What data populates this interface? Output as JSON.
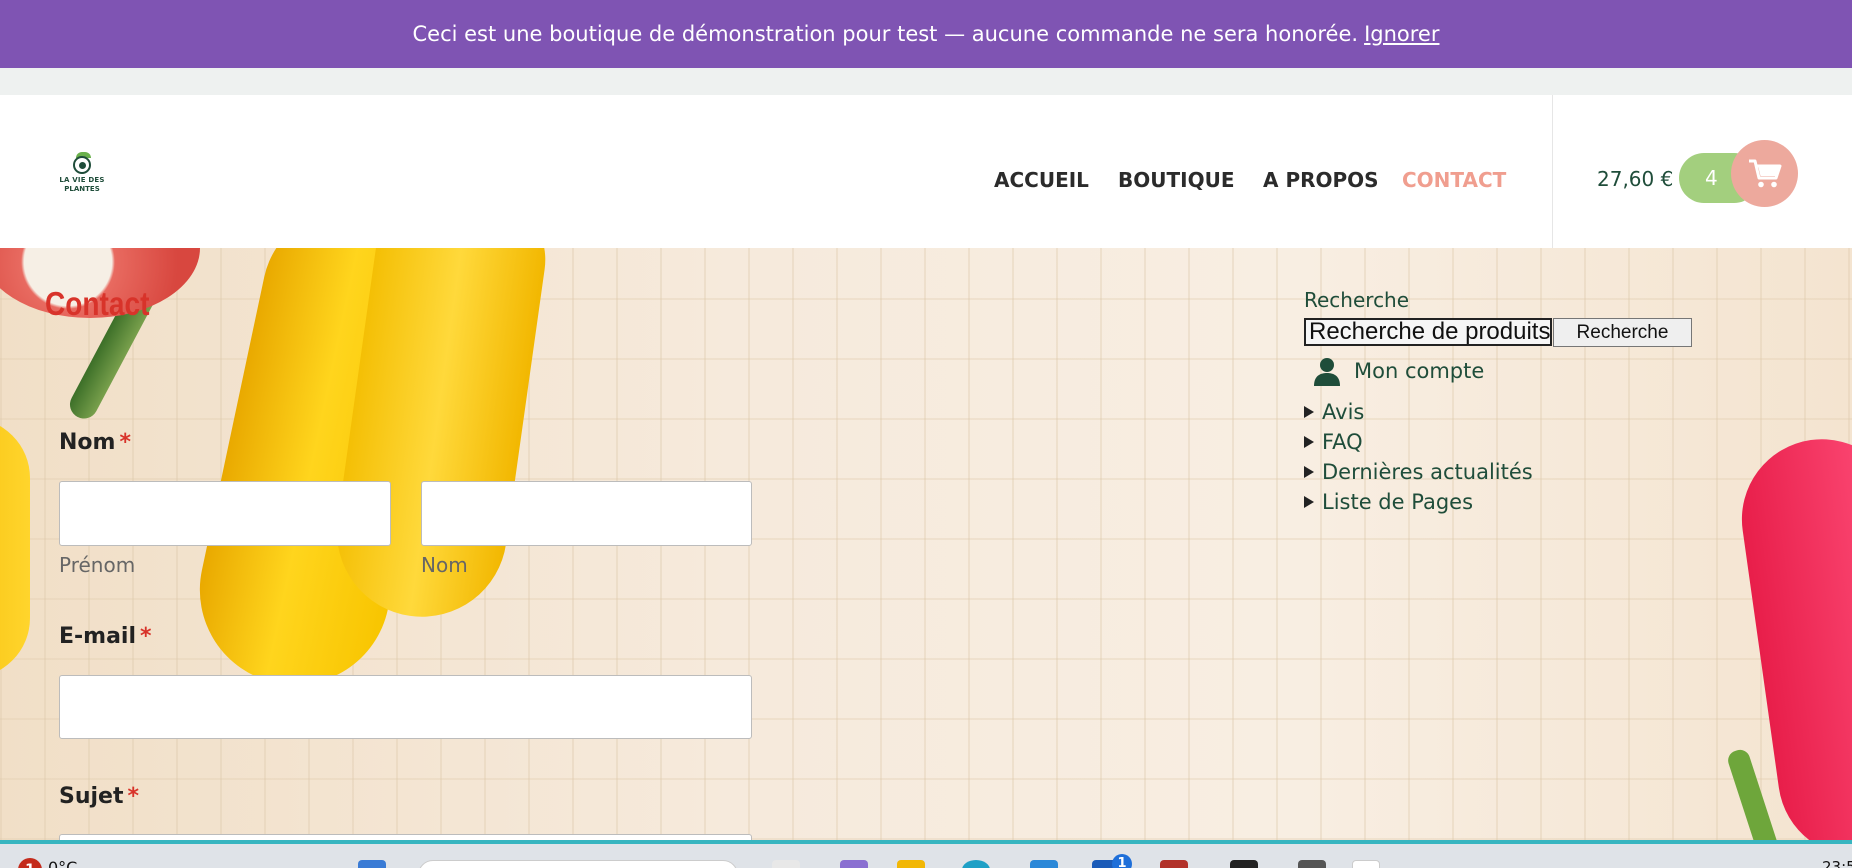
{
  "notice": {
    "text": "Ceci est une boutique de démonstration pour test — aucune commande ne sera honorée.",
    "dismiss_label": "Ignorer"
  },
  "logo": {
    "line1": "LA VIE DES",
    "line2": "PLANTES"
  },
  "nav": {
    "items": [
      {
        "label": "ACCUEIL"
      },
      {
        "label": "BOUTIQUE"
      },
      {
        "label": "A PROPOS"
      },
      {
        "label": "CONTACT",
        "active": true
      }
    ]
  },
  "cart": {
    "total": "27,60 €",
    "count": "4"
  },
  "page": {
    "title": "Contact"
  },
  "form": {
    "name_label": "Nom",
    "required_mark": "*",
    "first_name_sublabel": "Prénom",
    "last_name_sublabel": "Nom",
    "email_label": "E-mail",
    "subject_label": "Sujet"
  },
  "sidebar": {
    "search_title": "Recherche",
    "search_placeholder": "Recherche de produits…",
    "search_button": "Recherche",
    "account_label": "Mon compte",
    "items": [
      {
        "label": "Avis"
      },
      {
        "label": "FAQ"
      },
      {
        "label": "Dernières actualités"
      },
      {
        "label": "Liste de Pages"
      }
    ]
  },
  "taskbar": {
    "weather_badge": "1",
    "temperature": "0°C",
    "notification_count": "1",
    "time": "23:5"
  },
  "colors": {
    "notice_bg": "#7f54b3",
    "brand_green": "#1f4d3a",
    "nav_active": "#f09e8f",
    "cart_count_bg": "#a3cf7e",
    "cart_button_bg": "#eda99d",
    "title_red": "#d8332a"
  }
}
